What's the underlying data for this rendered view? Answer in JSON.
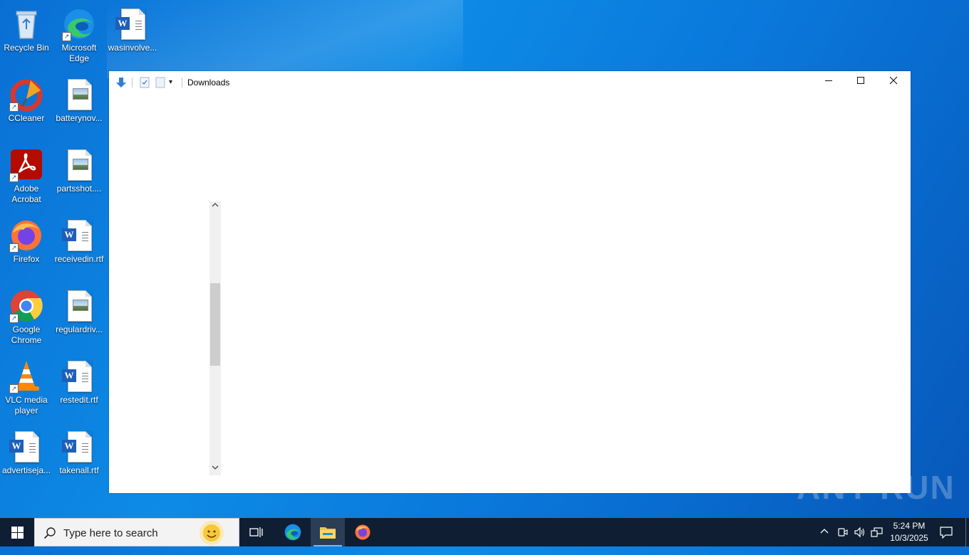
{
  "desktop": {
    "icons": [
      {
        "label": "Recycle Bin"
      },
      {
        "label": "Microsoft Edge"
      },
      {
        "label": "wasinvolve..."
      },
      {
        "label": "CCleaner"
      },
      {
        "label": "batterynov..."
      },
      {
        "label": "Adobe Acrobat"
      },
      {
        "label": "partsshot...."
      },
      {
        "label": "Firefox"
      },
      {
        "label": "receivedin.rtf"
      },
      {
        "label": "Google Chrome"
      },
      {
        "label": "regulardriv..."
      },
      {
        "label": "VLC media player"
      },
      {
        "label": "restedit.rtf"
      },
      {
        "label": "advertiseja..."
      },
      {
        "label": "takenall.rtf"
      }
    ]
  },
  "window": {
    "title": "Downloads",
    "minimize_icon": "minimize-icon",
    "maximize_icon": "maximize-icon",
    "close_icon": "close-icon"
  },
  "watermark": "ANY RUN",
  "taskbar": {
    "search_placeholder": "Type here to search",
    "apps": [
      "task-view",
      "microsoft-edge",
      "file-explorer",
      "firefox"
    ],
    "clock_time": "5:24 PM",
    "clock_date": "10/3/2025"
  },
  "colors": {
    "desktop_accent": "#0a78dc",
    "taskbar": "#0f1e33",
    "word_blue": "#1f5fb8"
  }
}
